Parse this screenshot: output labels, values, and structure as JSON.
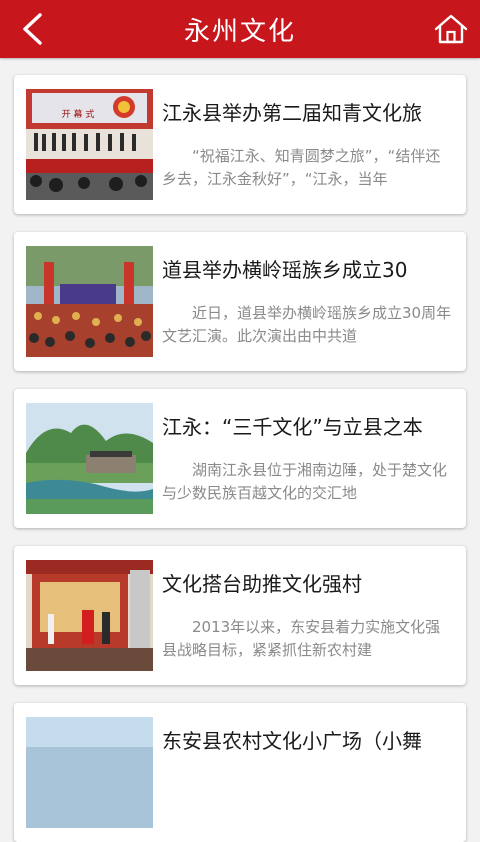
{
  "header": {
    "title": "永州文化",
    "back_icon": "chevron-left-icon",
    "home_icon": "home-icon",
    "bg_color": "#c8161d"
  },
  "articles": [
    {
      "headline": "江永县举办第二届知青文化旅",
      "summary": "“祝福江永、知青圆梦之旅”，“结伴还乡去，江永金秋好”，“江永，当年",
      "thumb_banner": "开 幕 式"
    },
    {
      "headline": "道县举办横岭瑶族乡成立30",
      "summary": "近日，道县举办横岭瑶族乡成立30周年文艺汇演。此次演出由中共道"
    },
    {
      "headline": "江永：“三千文化”与立县之本",
      "summary": "湖南江永县位于湘南边陲，处于楚文化与少数民族百越文化的交汇地"
    },
    {
      "headline": "文化搭台助推文化强村",
      "summary": "2013年以来，东安县着力实施文化强县战略目标，紧紧抓住新农村建"
    },
    {
      "headline": "东安县农村文化小广场（小舞",
      "summary": ""
    }
  ]
}
